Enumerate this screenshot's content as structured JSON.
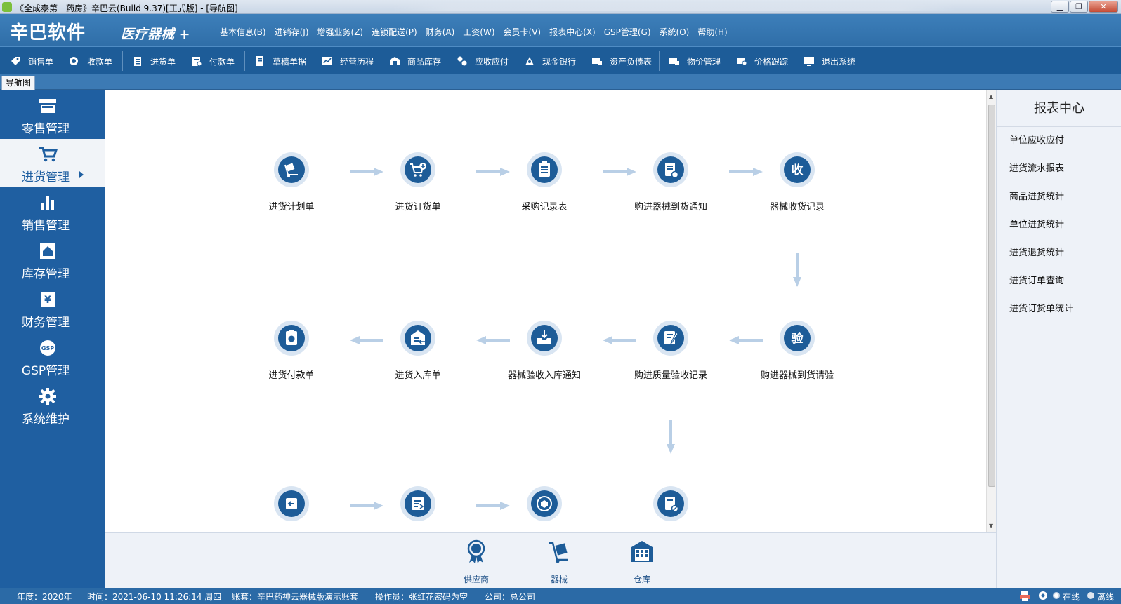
{
  "window": {
    "title": "《全成泰第一药房》辛巴云(Build 9.37)[正式版] - [导航图]"
  },
  "brand": {
    "logo": "辛巴软件",
    "product": "医疗器械 +"
  },
  "menu": [
    "基本信息(B)",
    "进销存(J)",
    "增强业务(Z)",
    "连锁配送(P)",
    "财务(A)",
    "工资(W)",
    "会员卡(V)",
    "报表中心(X)",
    "GSP管理(G)",
    "系统(O)",
    "帮助(H)"
  ],
  "toolbar": [
    {
      "label": "销售单",
      "icon": "tag-icon"
    },
    {
      "label": "收款单",
      "icon": "coins-icon"
    },
    {
      "label": "进货单",
      "icon": "clipboard-icon"
    },
    {
      "label": "付款单",
      "icon": "bill-icon"
    },
    {
      "label": "草稿单据",
      "icon": "draft-icon"
    },
    {
      "label": "经营历程",
      "icon": "chart-line-icon"
    },
    {
      "label": "商品库存",
      "icon": "warehouse-icon"
    },
    {
      "label": "应收应付",
      "icon": "exchange-icon"
    },
    {
      "label": "现金银行",
      "icon": "bank-icon"
    },
    {
      "label": "资产负债表",
      "icon": "balance-icon"
    },
    {
      "label": "物价管理",
      "icon": "price-icon"
    },
    {
      "label": "价格跟踪",
      "icon": "price-track-icon"
    },
    {
      "label": "退出系统",
      "icon": "monitor-exit-icon"
    }
  ],
  "tabs": {
    "nav": "导航图"
  },
  "sidebar": [
    {
      "label": "零售管理",
      "icon": "store-icon"
    },
    {
      "label": "进货管理",
      "icon": "cart-icon",
      "active": true
    },
    {
      "label": "销售管理",
      "icon": "bar-chart-icon"
    },
    {
      "label": "库存管理",
      "icon": "house-icon"
    },
    {
      "label": "财务管理",
      "icon": "yen-icon"
    },
    {
      "label": "GSP管理",
      "icon": "gsp-icon"
    },
    {
      "label": "系统维护",
      "icon": "gear-icon"
    }
  ],
  "flow": {
    "row1": [
      "进货计划单",
      "进货订货单",
      "采购记录表",
      "购进器械到货通知",
      "器械收货记录"
    ],
    "row2": [
      "进货付款单",
      "进货入库单",
      "器械验收入库通知",
      "购进质量验收记录",
      "购进器械到货请验"
    ],
    "receive_char": "收",
    "inspect_char": "验"
  },
  "bottom": [
    {
      "label": "供应商",
      "icon": "supplier-icon"
    },
    {
      "label": "器械",
      "icon": "device-icon"
    },
    {
      "label": "仓库",
      "icon": "warehouse-building-icon"
    }
  ],
  "report_panel": {
    "title": "报表中心",
    "items": [
      "单位应收应付",
      "进货流水报表",
      "商品进货统计",
      "单位进货统计",
      "进货退货统计",
      "进货订单查询",
      "进货订货单统计"
    ]
  },
  "status": {
    "year": "年度：2020年",
    "time": "时间：2021-06-10 11:26:14 周四",
    "account": "账套：辛巴药神云器械版演示账套",
    "operator": "操作员：张红花密码为空",
    "company": "公司：总公司",
    "online": "在线",
    "offline": "离线"
  },
  "colors": {
    "primary": "#1d5c98",
    "sidebar": "#1f5fa1",
    "circle_bg": "#d9e5f2",
    "arrow": "#b9cfe6"
  }
}
